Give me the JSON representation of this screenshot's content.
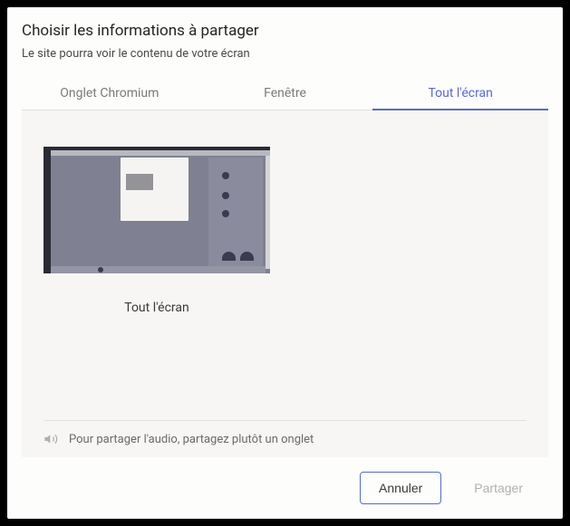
{
  "dialog": {
    "title": "Choisir les informations à partager",
    "subtitle": "Le site pourra voir le contenu de votre écran"
  },
  "tabs": {
    "chromium": "Onglet Chromium",
    "window": "Fenêtre",
    "fullscreen": "Tout l'écran"
  },
  "screen": {
    "label": "Tout l'écran"
  },
  "audio_hint": "Pour partager l'audio, partagez plutôt un onglet",
  "buttons": {
    "cancel": "Annuler",
    "share": "Partager"
  }
}
